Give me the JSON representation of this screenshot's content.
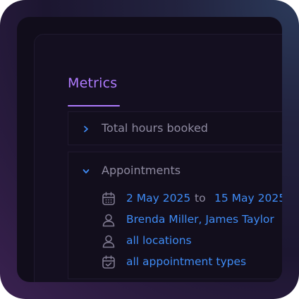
{
  "metrics_tab": {
    "label": "Metrics"
  },
  "sections": {
    "hours": {
      "title": "Total hours booked",
      "expanded": false
    },
    "appointments": {
      "title": "Appointments",
      "expanded": true,
      "date_from": "2 May 2025",
      "date_sep": "to",
      "date_to": "15 May 2025",
      "staff": "Brenda Miller, James Taylor",
      "locations": "all locations",
      "types": "all appointment types"
    }
  },
  "colors": {
    "accent": "#b07cff",
    "link": "#3f8cf6",
    "muted": "#8e8aa0",
    "icon": "#7f7a90"
  },
  "icons": {
    "chevron_collapsed": "chevron-right-icon",
    "chevron_expanded": "chevron-down-icon",
    "date": "calendar-icon",
    "staff": "user-icon",
    "location": "user-icon",
    "type": "calendar-check-icon"
  }
}
